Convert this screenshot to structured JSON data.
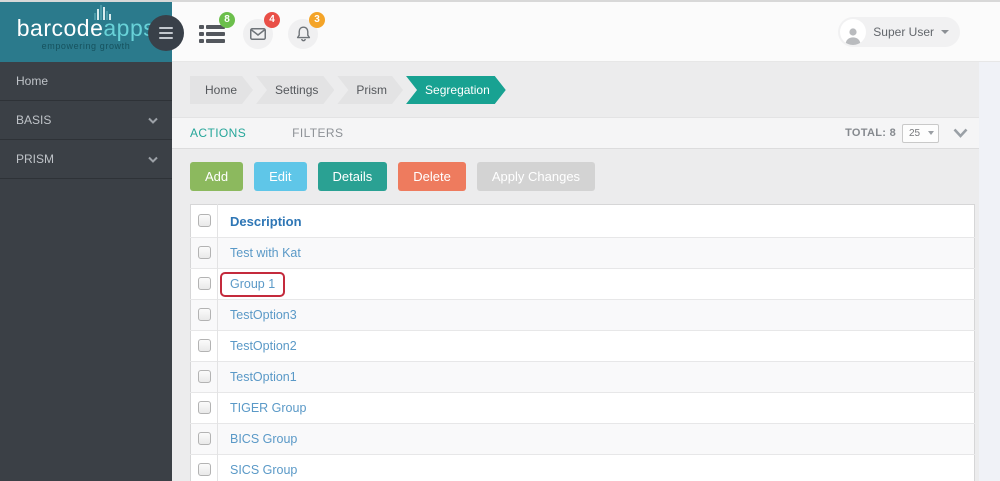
{
  "brand": {
    "logo_primary": "barcode",
    "logo_secondary": "apps",
    "tagline": "empowering growth",
    "header_bg": "#2b7a8c"
  },
  "topbar": {
    "notifications": [
      {
        "icon": "list-icon",
        "count": "8",
        "badge_color": "#6cbf4c"
      },
      {
        "icon": "mail-icon",
        "count": "4",
        "badge_color": "#e94f47"
      },
      {
        "icon": "bell-icon",
        "count": "3",
        "badge_color": "#f4a428"
      }
    ],
    "user": {
      "name": "Super User"
    }
  },
  "sidebar": {
    "items": [
      {
        "label": "Home",
        "expandable": false
      },
      {
        "label": "BASIS",
        "expandable": true
      },
      {
        "label": "PRISM",
        "expandable": true
      }
    ]
  },
  "breadcrumb": {
    "items": [
      {
        "label": "Home",
        "active": false
      },
      {
        "label": "Settings",
        "active": false
      },
      {
        "label": "Prism",
        "active": false
      },
      {
        "label": "Segregation",
        "active": true
      }
    ],
    "active_color": "#18a292"
  },
  "tabs": {
    "actions_label": "ACTIONS",
    "filters_label": "FILTERS",
    "active_color": "#26a69a"
  },
  "pagination": {
    "total_label": "TOTAL: 8",
    "page_size": "25"
  },
  "toolbar": {
    "buttons": [
      {
        "label": "Add",
        "color": "#8cb95e",
        "enabled": true
      },
      {
        "label": "Edit",
        "color": "#5fc6e8",
        "enabled": true
      },
      {
        "label": "Details",
        "color": "#2aa193",
        "enabled": true
      },
      {
        "label": "Delete",
        "color": "#ee7b5e",
        "enabled": true
      },
      {
        "label": "Apply Changes",
        "color": "#d3d3d3",
        "enabled": false
      }
    ]
  },
  "table": {
    "header": "Description",
    "rows": [
      "Test with Kat",
      "Group 1",
      "TestOption3",
      "TestOption2",
      "TestOption1",
      "TIGER Group",
      "BICS Group",
      "SICS Group"
    ],
    "highlighted_row": "Group 1",
    "highlight_color": "#c42a3c",
    "link_color": "#5a99c7"
  }
}
